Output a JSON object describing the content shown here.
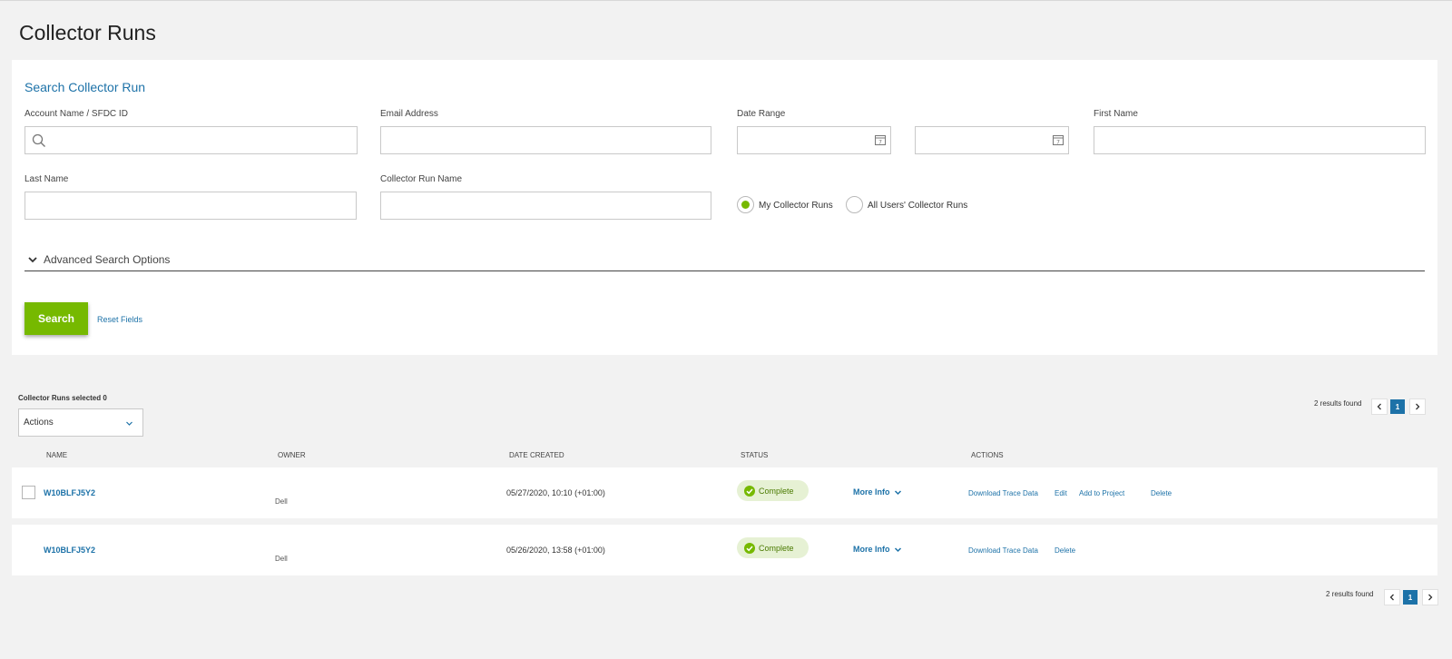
{
  "page": {
    "title": "Collector Runs"
  },
  "search": {
    "title": "Search Collector Run",
    "account_label": "Account Name / SFDC ID",
    "email_label": "Email Address",
    "date_range_label": "Date Range",
    "first_name_label": "First Name",
    "last_name_label": "Last Name",
    "collector_run_name_label": "Collector Run Name",
    "radio_mine": "My Collector Runs",
    "radio_all": "All Users' Collector Runs",
    "advanced": "Advanced Search Options",
    "search_button": "Search",
    "reset_link": "Reset Fields"
  },
  "results": {
    "selected_text": "Collector Runs selected 0",
    "actions_select": "Actions",
    "count_text": "2 results found",
    "current_page": "1",
    "columns": [
      "NAME",
      "OWNER",
      "DATE CREATED",
      "STATUS",
      "ACTIONS"
    ],
    "more_info_label": "More Info",
    "rows": [
      {
        "name": "W10BLFJ5Y2",
        "owner": "Dell",
        "date": "05/27/2020, 10:10 (+01:00)",
        "status": "Complete",
        "actions": [
          "Download Trace Data",
          "Edit",
          "Add to Project",
          "Delete"
        ]
      },
      {
        "name": "W10BLFJ5Y2",
        "owner": "Dell",
        "date": "05/26/2020, 13:58 (+01:00)",
        "status": "Complete",
        "actions": [
          "Download Trace Data",
          "Delete"
        ]
      }
    ]
  },
  "colors": {
    "accent": "#1d72a8",
    "brand_green": "#76b900",
    "status_bg": "#e6f1d4"
  }
}
